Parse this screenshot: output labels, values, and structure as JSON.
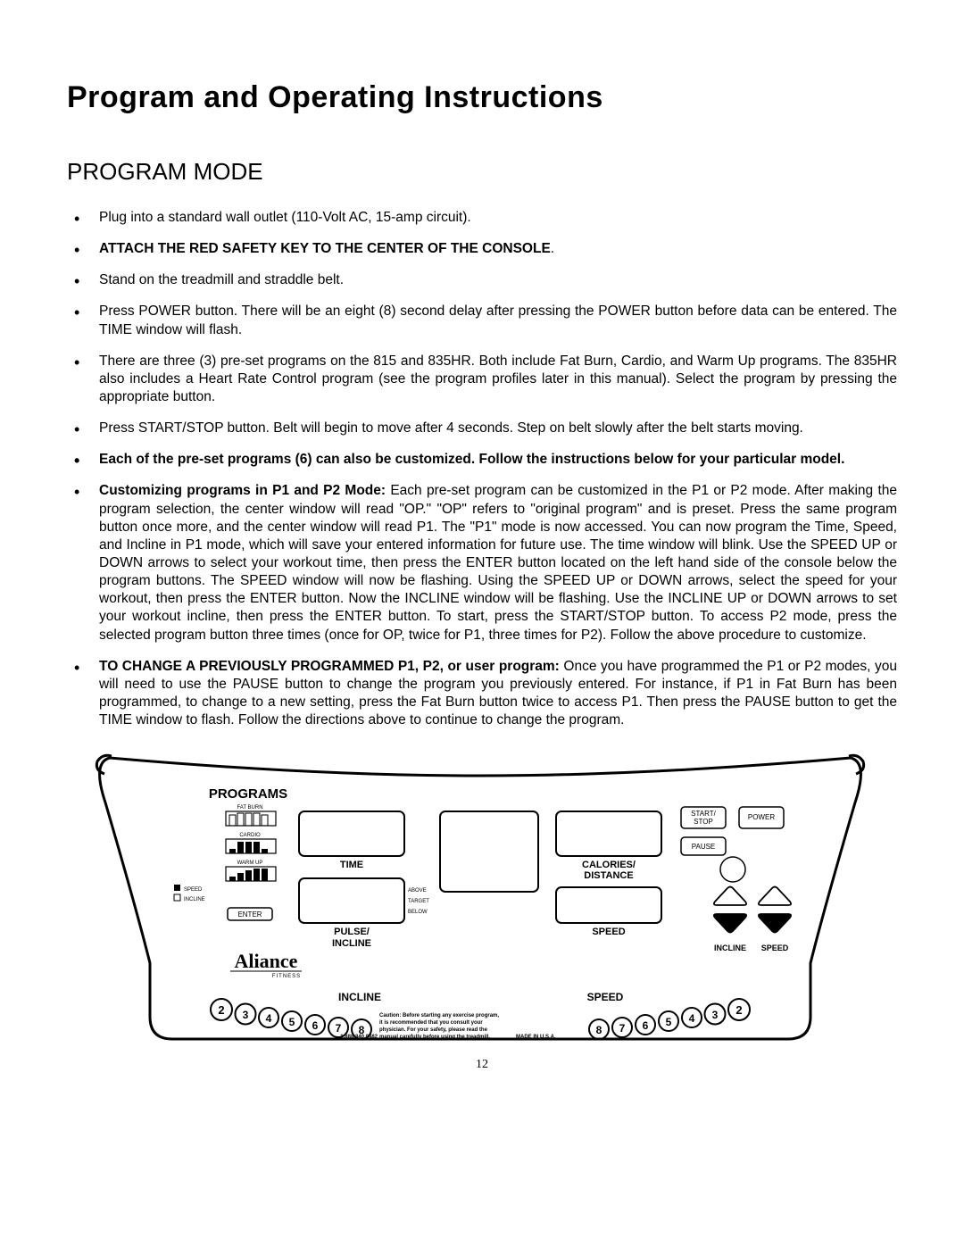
{
  "title": "Program and Operating Instructions",
  "section": "PROGRAM MODE",
  "bullets": {
    "b1": "Plug into a standard wall outlet (110-Volt AC, 15-amp circuit).",
    "b2": "ATTACH THE RED SAFETY KEY TO THE CENTER OF THE CONSOLE",
    "b2_punct": ".",
    "b3": "Stand on the treadmill and straddle belt.",
    "b4": "Press POWER button.  There will be an eight (8) second delay after pressing the POWER button before data can be entered.  The TIME window will flash.",
    "b5": "There are three (3) pre-set programs on the 815 and 835HR.  Both include Fat Burn, Cardio, and Warm Up programs. The 835HR also includes a Heart Rate Control program  (see the program profiles later in this manual).  Select the program by pressing the appropriate button.",
    "b6": "Press START/STOP button.  Belt will begin to move after 4 seconds.  Step on belt slowly after the belt starts moving.",
    "b7": "Each of the pre-set programs (6) can also be customized.  Follow the instructions below for your particular model.",
    "b8_lead": "Customizing programs in P1 and P2 Mode:",
    "b8_body": " Each pre-set program can be customized in the P1 or P2 mode.  After making the program selection, the center window will read \"OP.\"  \"OP\" refers to \"original program\" and is preset.  Press the same program button once more, and the center window will read P1.  The \"P1\" mode is now accessed.  You can now program the Time, Speed, and Incline in P1 mode, which will save your entered information for future use. The time window will blink.  Use the SPEED UP or DOWN arrows to select your workout time, then press the ENTER button located on the left hand side of the console below the program buttons.  The SPEED window will now be flashing.  Using the SPEED UP or DOWN arrows, select the speed for your workout, then press the ENTER button.  Now the INCLINE window will be flashing.  Use the INCLINE UP or DOWN arrows to set your workout incline, then press the ENTER button.  To start, press the START/STOP button.  To access P2 mode, press the selected program button three times (once for OP, twice for P1, three times for P2).  Follow the above procedure to customize.",
    "b9_lead": "TO CHANGE A PREVIOUSLY PROGRAMMED P1, P2, or user program:",
    "b9_body": "  Once you have programmed the P1 or P2 modes, you will need to use the PAUSE button to change the program you previously entered.  For instance, if P1 in Fat Burn has been programmed, to change to a new setting, press the Fat Burn button twice to access P1.  Then press the PAUSE button to get the TIME window to flash.  Follow the directions above to continue to change the program."
  },
  "console": {
    "programs": "PROGRAMS",
    "fat_burn": "FAT BURN",
    "cardio": "CARDIO",
    "warm_up": "WARM UP",
    "speed_mark": "SPEED",
    "incline_mark": "INCLINE",
    "enter": "ENTER",
    "time": "TIME",
    "pulse_incline_1": "PULSE/",
    "pulse_incline_2": "INCLINE",
    "calories_1": "CALORIES/",
    "calories_2": "DISTANCE",
    "speed_lbl": "SPEED",
    "start_stop_1": "START/",
    "start_stop_2": "STOP",
    "power": "POWER",
    "pause": "PAUSE",
    "above": "ABOVE",
    "target": "TARGET",
    "below": "BELOW",
    "brand": "Aliance",
    "brand_sub": "FITNESS",
    "incline_btm": "INCLINE",
    "speed_btm": "SPEED",
    "incline_lbl_bot": "INCLINE",
    "speed_lbl_bot": "SPEED",
    "presets": [
      "2",
      "3",
      "4",
      "5",
      "6",
      "7",
      "8",
      "8",
      "7",
      "6",
      "5",
      "4",
      "3",
      "2"
    ],
    "caution1": "Caution: Before starting any exercise program,",
    "caution2": "it is recommended that you consult your",
    "caution3": "physician. For your safety, please read the",
    "caution4": "manual carefully before using the treadmill.",
    "phone": "1.888.340.0482",
    "made": "MADE IN U.S.A."
  },
  "page_number": "12"
}
